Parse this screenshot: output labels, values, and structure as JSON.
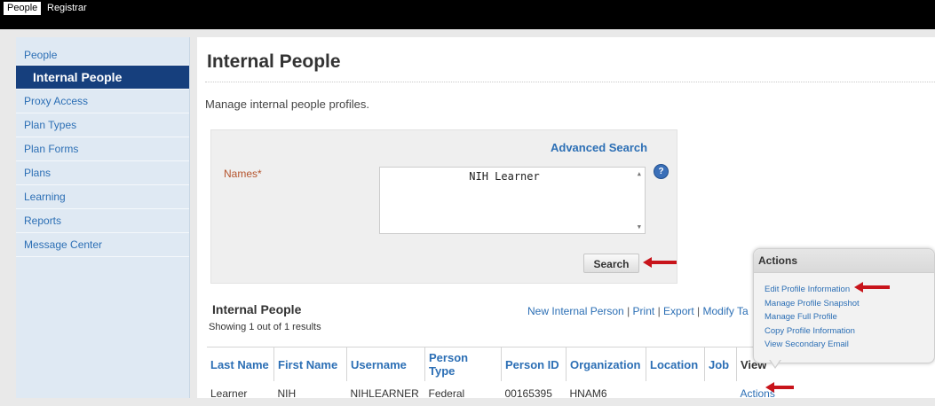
{
  "topnav": {
    "tabs": [
      "People",
      "Registrar"
    ]
  },
  "sidebar": {
    "items": [
      "People",
      "Internal People",
      "Proxy Access",
      "Plan Types",
      "Plan Forms",
      "Plans",
      "Learning",
      "Reports",
      "Message Center"
    ]
  },
  "main": {
    "title": "Internal People",
    "description": "Manage internal people profiles."
  },
  "search": {
    "advanced_link": "Advanced Search",
    "names_label": "Names*",
    "names_value": "NIH Learner",
    "help_icon": "?",
    "button_label": "Search"
  },
  "results": {
    "title": "Internal People",
    "count_text": "Showing 1 out of 1 results",
    "links": [
      "New Internal Person",
      "Print",
      "Export",
      "Modify Ta"
    ],
    "columns": [
      "Last Name",
      "First Name",
      "Username",
      "Person Type",
      "Person ID",
      "Organization",
      "Location",
      "Job",
      "View"
    ],
    "rows": [
      [
        "Learner",
        "NIH",
        "NIHLEARNER",
        "Federal",
        "00165395",
        "HNAM6",
        "",
        "",
        "Actions"
      ]
    ]
  },
  "actions_popup": {
    "title": "Actions",
    "items": [
      "Edit Profile Information",
      "Manage Profile Snapshot",
      "Manage Full Profile",
      "Copy Profile Information",
      "View Secondary Email"
    ]
  },
  "colors": {
    "link_blue": "#2c6fb5",
    "sidebar_active": "#163f7d",
    "annotation_arrow": "#c8141b"
  }
}
